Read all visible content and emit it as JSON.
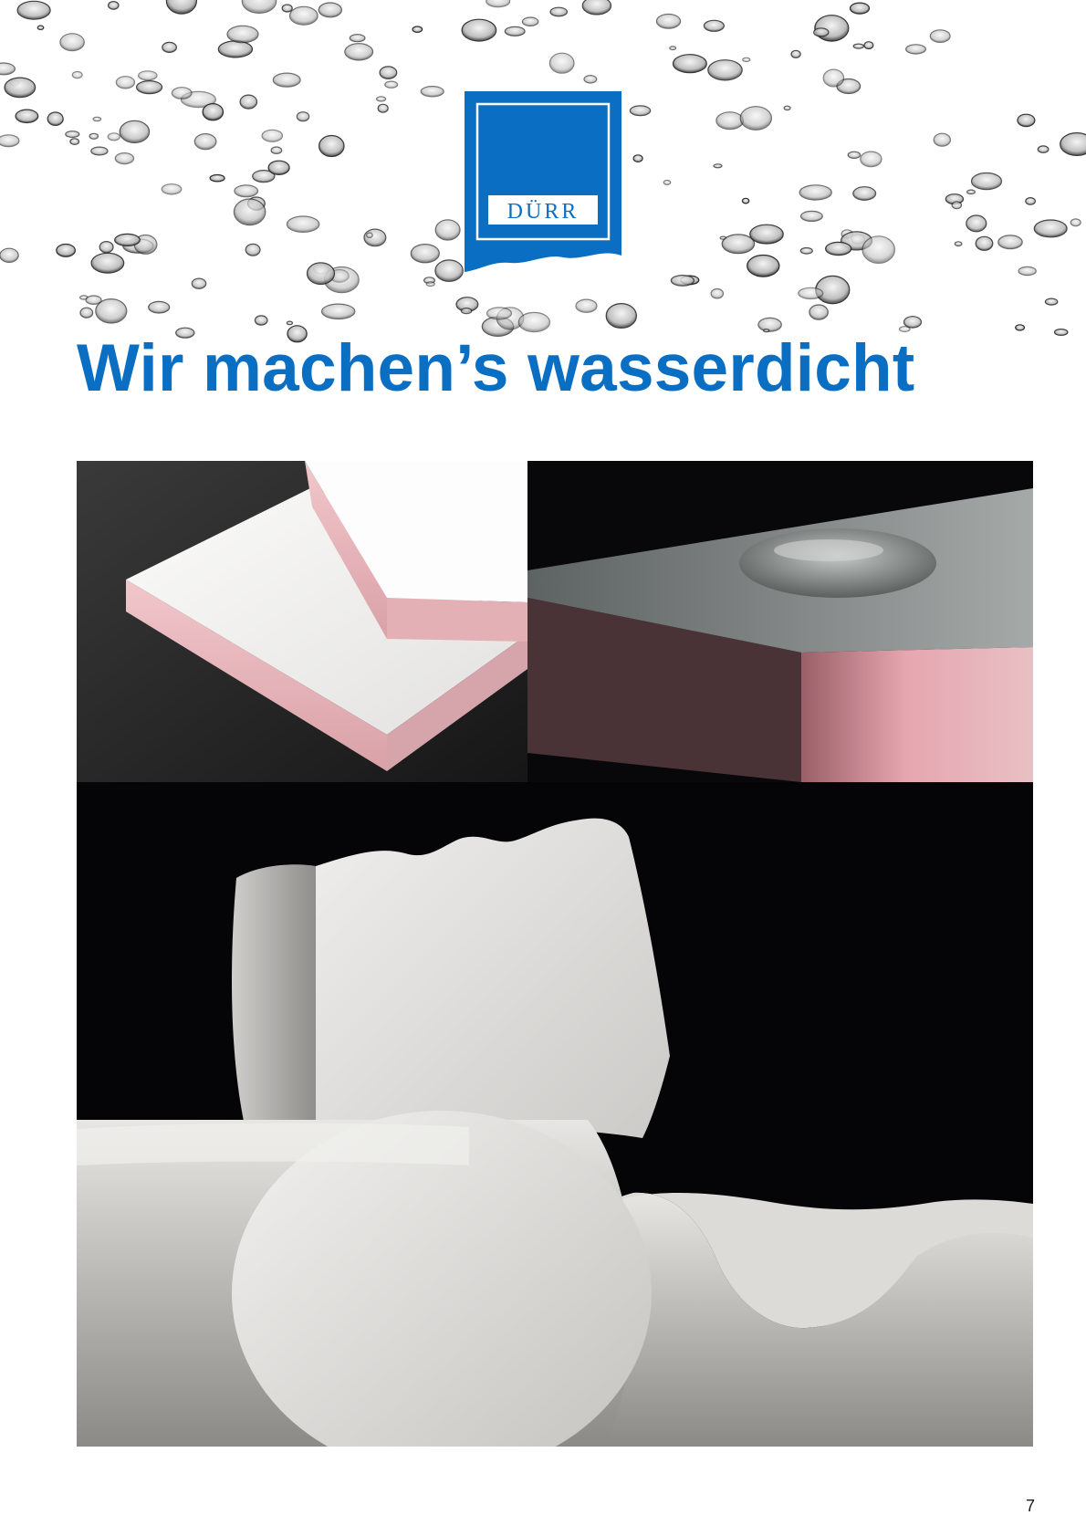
{
  "page": {
    "headline": "Wir machen’s wasserdicht",
    "page_number": "7"
  },
  "logo": {
    "brand_text": "DÜRR",
    "background_color": "#0a6fc2",
    "text_color": "#ffffff"
  },
  "colors": {
    "accent_blue": "#0a6fc2",
    "photo_background": "#050508",
    "foam_white": "#e9e8e6",
    "foam_pink": "#e7b3b8",
    "foam_grey": "#8b9090"
  },
  "photos": [
    {
      "subject": "white-pink-foam-boards"
    },
    {
      "subject": "grey-foam-block-with-water-drop"
    },
    {
      "subject": "shaped-white-foam-pieces"
    }
  ]
}
